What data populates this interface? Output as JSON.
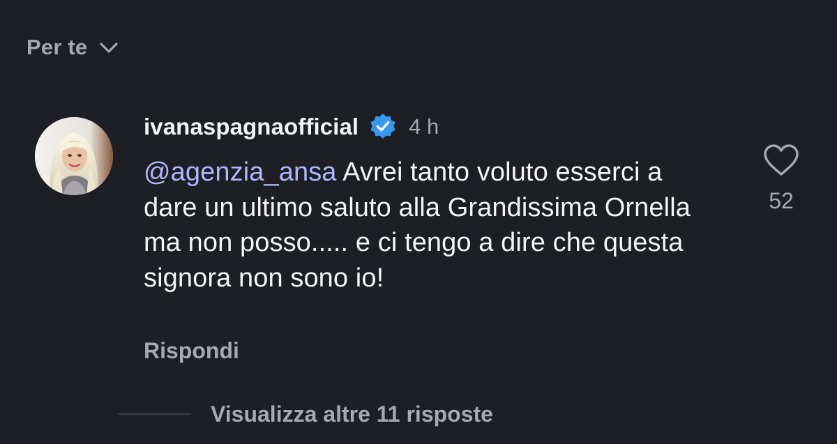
{
  "header": {
    "feed_filter_label": "Per te",
    "feed_filter_icon": "chevron-down-icon"
  },
  "comment": {
    "avatar_icon": "user-avatar",
    "username": "ivanaspagnaofficial",
    "verified_icon": "verified-badge-icon",
    "verified_color": "#3897f0",
    "timestamp": "4 h",
    "mention": "@agenzia_ansa",
    "text": " Avrei tanto voluto esserci a dare un ultimo saluto alla Grandissima Ornella ma non posso..... e ci tengo a dire che questa signora non sono io!",
    "like_icon": "heart-icon",
    "like_count": "52",
    "reply_label": "Rispondi",
    "view_replies_label": "Visualizza altre 11 risposte"
  },
  "colors": {
    "background": "#1e1f24",
    "primary_text": "#f3f5f7",
    "secondary_text": "#a6a9ae",
    "mention": "#afb6ff"
  }
}
